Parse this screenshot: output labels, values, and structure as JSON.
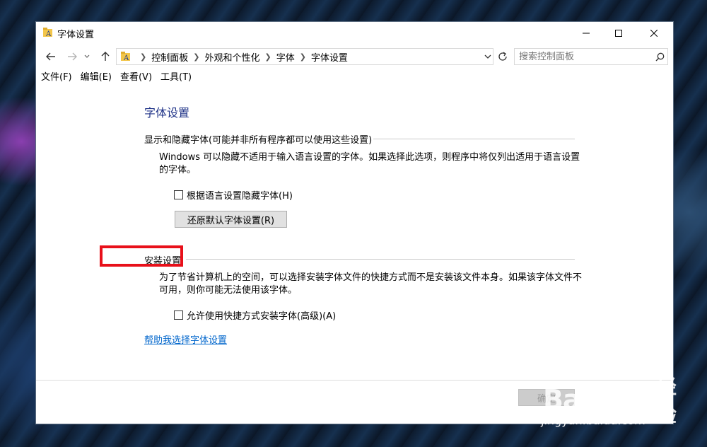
{
  "window": {
    "title": "字体设置"
  },
  "navbar": {
    "breadcrumbs": [
      "控制面板",
      "外观和个性化",
      "字体",
      "字体设置"
    ],
    "search_placeholder": "搜索控制面板"
  },
  "menubar": {
    "items": [
      "文件(F)",
      "编辑(E)",
      "查看(V)",
      "工具(T)"
    ]
  },
  "main": {
    "page_title": "字体设置",
    "show_hide_group": {
      "heading": "显示和隐藏字体(可能并非所有程序都可以使用这些设置)",
      "description": "Windows 可以隐藏不适用于输入语言设置的字体。如果选择此选项，则程序中将仅列出适用于语言设置的字体。",
      "checkbox_label": "根据语言设置隐藏字体(H)",
      "checkbox_checked": false,
      "restore_button": "还原默认字体设置(R)"
    },
    "install_group": {
      "heading": "安装设置",
      "description": "为了节省计算机上的空间，可以选择安装字体文件的快捷方式而不是安装该文件本身。如果该字体文件不可用，则你可能无法使用该字体。",
      "checkbox_label": "允许使用快捷方式安装字体(高级)(A)",
      "checkbox_checked": false
    },
    "help_link": "帮助我选择字体设置"
  },
  "footer": {
    "ok_button": "确定"
  },
  "watermark": {
    "logo_latin": "Bai",
    "logo_latin_2": "du",
    "logo_cn": "经验",
    "url": "jingyan.baidu.com"
  },
  "colors": {
    "title_blue": "#1e3287",
    "link_blue": "#0066cc",
    "highlight_red": "#e8101a"
  }
}
